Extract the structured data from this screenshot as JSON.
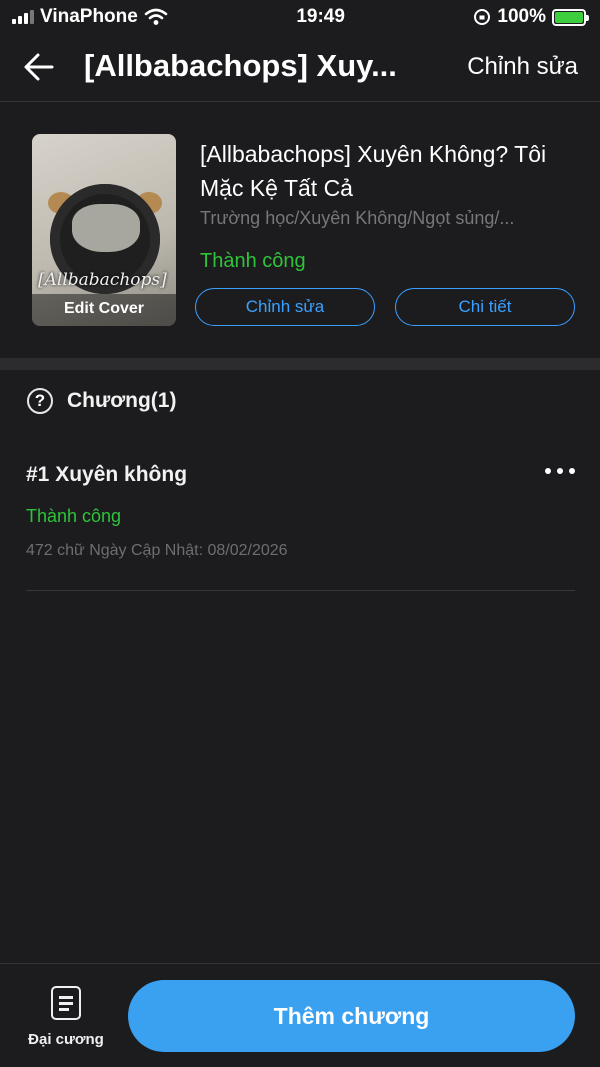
{
  "status_bar": {
    "carrier": "VinaPhone",
    "time": "19:49",
    "battery": "100%"
  },
  "header": {
    "title": "[Allbabachops] Xuy...",
    "edit_label": "Chỉnh sửa"
  },
  "book": {
    "title": "[Allbabachops] Xuyên Không? Tôi Mặc Kệ Tất Cả",
    "genres": "Trường học/Xuyên Không/Ngọt sủng/...",
    "status": "Thành công",
    "cover_logo": "[Allbabachops]",
    "cover_edit_label": "Edit Cover",
    "edit_button": "Chỉnh sửa",
    "detail_button": "Chi tiết"
  },
  "chapters": {
    "header": "Chương(1)",
    "items": [
      {
        "title": "#1 Xuyên không",
        "status": "Thành công",
        "meta": "472 chữ Ngày Cập Nhật: 08/02/2026"
      }
    ]
  },
  "bottom_bar": {
    "outline_label": "Đại cương",
    "add_chapter_label": "Thêm chương"
  },
  "colors": {
    "accent_blue": "#3aa0f0",
    "success_green": "#2fc33a",
    "background": "#1c1c1e"
  }
}
